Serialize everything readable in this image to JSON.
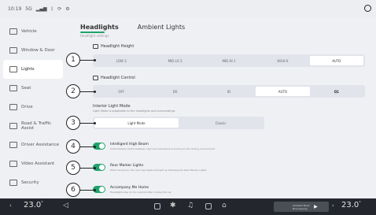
{
  "status_bar": {
    "time": "10:19",
    "network": "5G",
    "items": [
      "wifi",
      "bluetooth",
      "sync",
      "settings"
    ]
  },
  "sidebar": {
    "items": [
      {
        "label": "Vehicle",
        "icon": "car-icon"
      },
      {
        "label": "Window & Door",
        "icon": "window-icon"
      },
      {
        "label": "Lights",
        "icon": "light-icon",
        "active": true
      },
      {
        "label": "Seat",
        "icon": "seat-icon"
      },
      {
        "label": "Drive",
        "icon": "drive-icon"
      },
      {
        "label": "Road & Traffic Assist",
        "icon": "road-icon"
      },
      {
        "label": "Driver Assistance",
        "icon": "assist-icon"
      },
      {
        "label": "Video Assistant",
        "icon": "video-icon"
      },
      {
        "label": "Security",
        "icon": "lock-icon"
      }
    ]
  },
  "tabs": [
    {
      "label": "Headlights",
      "active": true
    },
    {
      "label": "Ambient Lights",
      "active": false
    }
  ],
  "tab_subtitle": "Headlight settings",
  "sections": {
    "height": {
      "title": "Headlight Height",
      "options": [
        "LOW 3",
        "MID LO 2",
        "MID HI 1",
        "HIGH 0",
        "AUTO"
      ],
      "selected": "AUTO"
    },
    "control": {
      "title": "Headlight Control",
      "options": [
        "OFF",
        "D0",
        "ID",
        "AUTO",
        "Q1"
      ],
      "selected": "AUTO"
    },
    "mode": {
      "title": "Interior Light Mode",
      "subtitle": "Light Mode is adaptable to the headlights and surroundings",
      "options": [
        "Light Mode",
        "Classic"
      ],
      "selected": "Light Mode"
    }
  },
  "toggles": [
    {
      "title": "Intelligent High Beam",
      "desc": "Automatically switch between high and low beams according to the driving environment",
      "on": true
    },
    {
      "title": "Rear Marker Lights",
      "desc": "When turned on, the rear logo lights will light up following the Rear Marker Lights",
      "on": true
    },
    {
      "title": "Accompany Me Home",
      "desc": "Headlights stay on for a period after locking the car",
      "on": true
    }
  ],
  "callouts": [
    "1",
    "2",
    "3",
    "4",
    "5",
    "6"
  ],
  "bottom_bar": {
    "temp_left": "23.0",
    "temp_right": "23.0",
    "temp_unit": "°",
    "media_title": "Ambient Music",
    "media_sub": "Now playing"
  }
}
